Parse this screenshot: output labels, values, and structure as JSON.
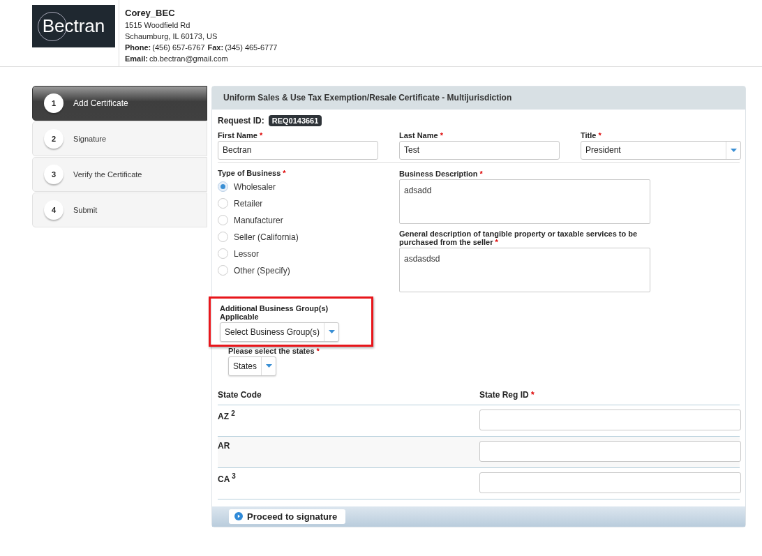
{
  "header": {
    "logo_text": "Bectran",
    "company": "Corey_BEC",
    "address_lines": [
      "1515 Woodfield Rd",
      "Schaumburg,  IL  60173,  US"
    ],
    "phone_label": "Phone:",
    "phone": "(456) 657-6767",
    "fax_label": "Fax:",
    "fax": "(345) 465-6777",
    "email_label": "Email:",
    "email": "cb.bectran@gmail.com"
  },
  "steps": [
    {
      "number": "1",
      "label": "Add Certificate",
      "selected": true
    },
    {
      "number": "2",
      "label": "Signature",
      "selected": false
    },
    {
      "number": "3",
      "label": "Verify the Certificate",
      "selected": false
    },
    {
      "number": "4",
      "label": "Submit",
      "selected": false
    }
  ],
  "form": {
    "title": "Uniform Sales & Use Tax Exemption/Resale Certificate - Multijurisdiction",
    "request_id_label": "Request ID:",
    "request_id": "REQ0143661",
    "name_fields": [
      {
        "kind": "text",
        "label": "First Name",
        "required_mark": "*",
        "value": "Bectran"
      },
      {
        "kind": "text",
        "label": "Last Name",
        "required_mark": "*",
        "value": "Test"
      },
      {
        "kind": "select",
        "label": "Title",
        "required_mark": "*",
        "value": "President"
      }
    ],
    "business_type": {
      "label": "Type of Business",
      "required_mark": "*",
      "options": [
        {
          "label": "Wholesaler",
          "selected": true
        },
        {
          "label": "Retailer",
          "selected": false
        },
        {
          "label": "Manufacturer",
          "selected": false
        },
        {
          "label": "Seller (California)",
          "selected": false
        },
        {
          "label": "Lessor",
          "selected": false
        },
        {
          "label": "Other (Specify)",
          "selected": false
        }
      ]
    },
    "descriptions": [
      {
        "label": "Business Description",
        "required_mark": "*",
        "value": "adsadd"
      },
      {
        "label": "General description of tangible property or taxable services to be purchased from the seller",
        "required_mark": "*",
        "value": "asdasdsd"
      }
    ],
    "business_group": {
      "label": "Additional Business Group(s) Applicable",
      "value": "Select Business Group(s)",
      "highlighted": true
    },
    "states": {
      "label": "Please select the states",
      "required_mark": "*",
      "value": "States"
    },
    "table": {
      "columns": [
        {
          "label": "State Code"
        },
        {
          "label": "State Reg ID",
          "required_mark": "*"
        }
      ],
      "rows": [
        {
          "code": "AZ $^{2}$"
        },
        {
          "code": "AR"
        },
        {
          "code": "CA $^{3}$"
        }
      ]
    },
    "proceed_button": "Proceed to signature"
  }
}
